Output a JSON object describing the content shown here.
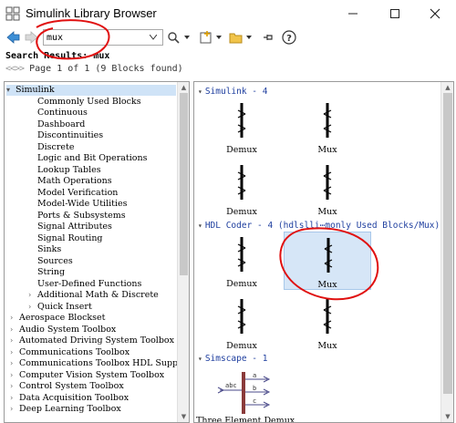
{
  "window": {
    "title": "Simulink Library Browser",
    "minimize_icon": "minimize-icon",
    "maximize_icon": "maximize-icon",
    "close_icon": "close-icon"
  },
  "toolbar": {
    "search_value": "mux",
    "search_placeholder": "",
    "icons": [
      "back-arrow-icon",
      "forward-arrow-icon",
      "search-options-icon",
      "new-model-icon",
      "open-folder-icon",
      "pin-icon",
      "help-icon"
    ]
  },
  "search": {
    "results_label": "Search Results: mux",
    "pager_nav": "<<>>",
    "pager_text": "Page 1 of 1 (9 Blocks found)"
  },
  "tree": {
    "root": "Simulink",
    "children": [
      "Commonly Used Blocks",
      "Continuous",
      "Dashboard",
      "Discontinuities",
      "Discrete",
      "Logic and Bit Operations",
      "Lookup Tables",
      "Math Operations",
      "Model Verification",
      "Model-Wide Utilities",
      "Ports & Subsystems",
      "Signal Attributes",
      "Signal Routing",
      "Sinks",
      "Sources",
      "String",
      "User-Defined Functions"
    ],
    "expandable_children": [
      "Additional Math & Discrete",
      "Quick Insert"
    ],
    "toolboxes": [
      "Aerospace Blockset",
      "Audio System Toolbox",
      "Automated Driving System Toolbox",
      "Communications Toolbox",
      "Communications Toolbox HDL Support",
      "Computer Vision System Toolbox",
      "Control System Toolbox",
      "Data Acquisition Toolbox",
      "Deep Learning Toolbox"
    ]
  },
  "results": {
    "sections": [
      {
        "header": "Simulink - 4",
        "blocks": [
          "Demux",
          "Mux",
          "Demux",
          "Mux"
        ]
      },
      {
        "header": "HDL Coder - 4 (hdlsllib/Commonly Used Blocks/Mux)",
        "header_display": "HDL Coder - 4 (hdlslli⋯monly Used Blocks/Mux)",
        "blocks": [
          "Demux",
          "Mux",
          "Demux",
          "Mux"
        ]
      },
      {
        "header": "Simscape - 1",
        "blocks": [
          "Three Element Demux"
        ],
        "port_labels": [
          "abc",
          "a",
          "b",
          "c"
        ]
      }
    ]
  },
  "colors": {
    "section_header": "#1f3f9f",
    "selection": "#d6e6f7",
    "annotation": "#e01010"
  }
}
